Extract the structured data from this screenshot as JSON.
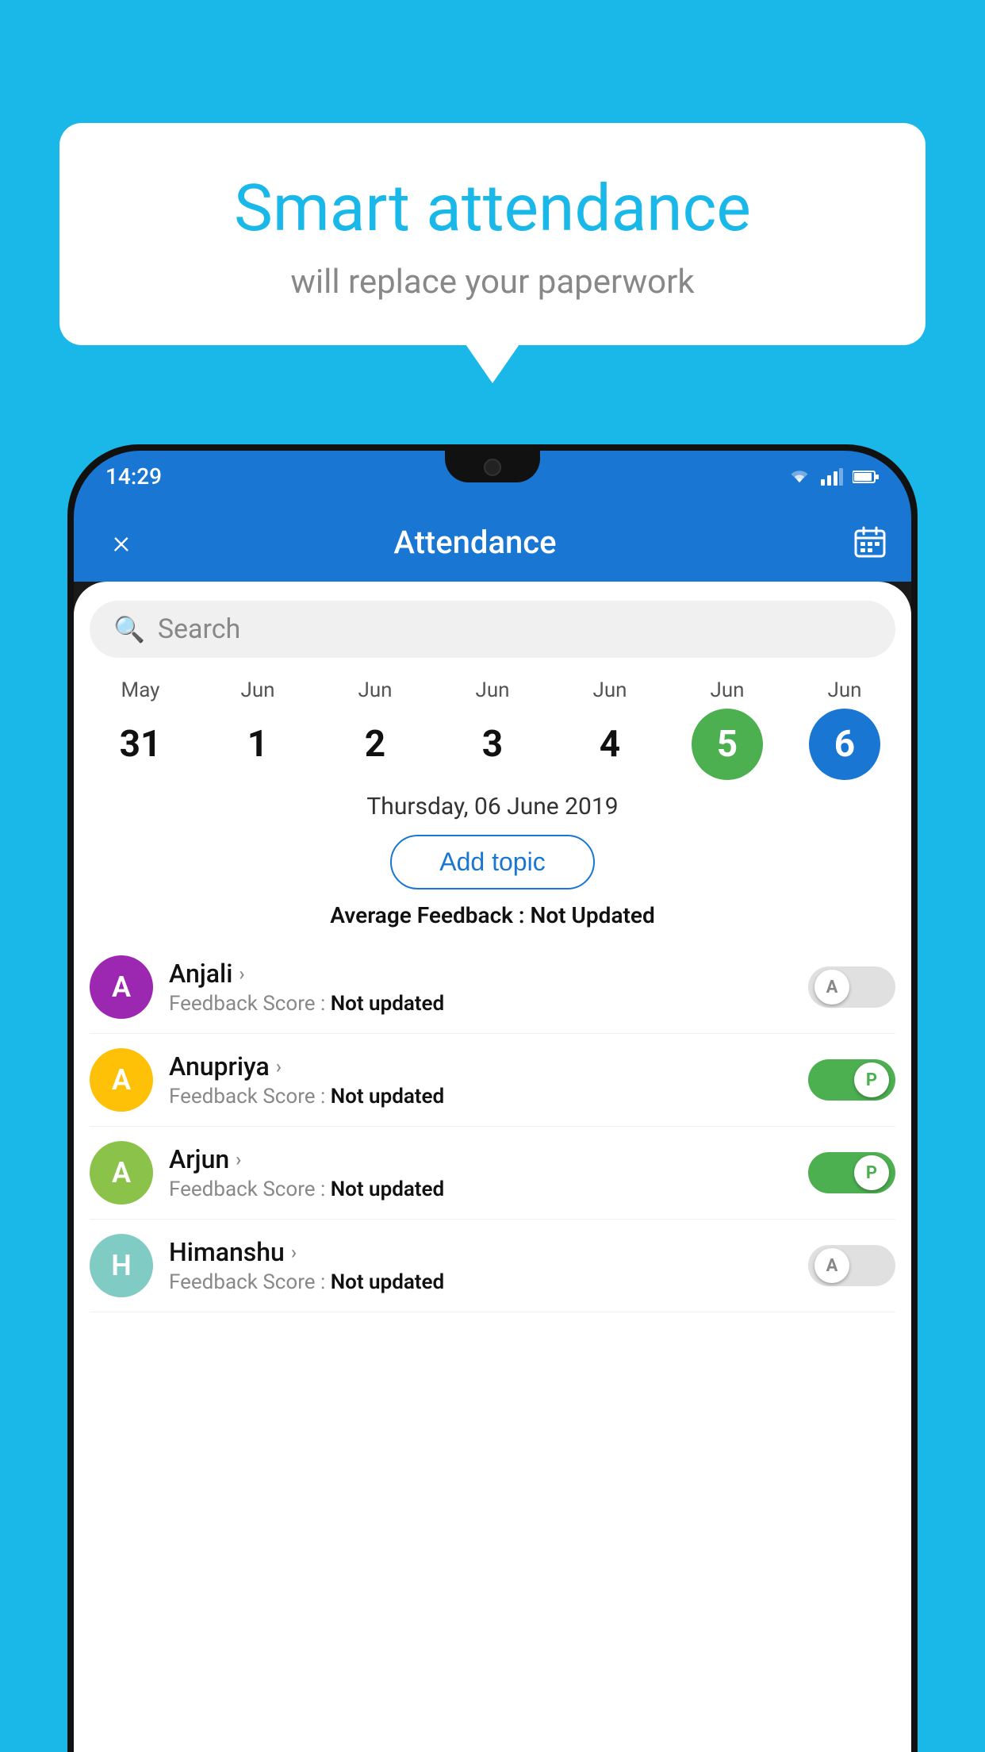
{
  "page": {
    "background_color": "#1ab8e8"
  },
  "bubble": {
    "title": "Smart attendance",
    "subtitle": "will replace your paperwork"
  },
  "status_bar": {
    "time": "14:29",
    "icons": [
      "wifi",
      "signal",
      "battery"
    ]
  },
  "app_bar": {
    "title": "Attendance",
    "close_icon": "×",
    "calendar_icon": "📅"
  },
  "search": {
    "placeholder": "Search"
  },
  "calendar": {
    "days": [
      {
        "month": "May",
        "num": "31",
        "state": "normal"
      },
      {
        "month": "Jun",
        "num": "1",
        "state": "normal"
      },
      {
        "month": "Jun",
        "num": "2",
        "state": "normal"
      },
      {
        "month": "Jun",
        "num": "3",
        "state": "normal"
      },
      {
        "month": "Jun",
        "num": "4",
        "state": "normal"
      },
      {
        "month": "Jun",
        "num": "5",
        "state": "today"
      },
      {
        "month": "Jun",
        "num": "6",
        "state": "selected"
      }
    ],
    "selected_date": "Thursday, 06 June 2019"
  },
  "add_topic_label": "Add topic",
  "avg_feedback": {
    "label": "Average Feedback : ",
    "value": "Not Updated"
  },
  "students": [
    {
      "name": "Anjali",
      "avatar_letter": "A",
      "avatar_color": "purple",
      "feedback": "Feedback Score : Not updated",
      "toggle_state": "off",
      "toggle_label": "A"
    },
    {
      "name": "Anupriya",
      "avatar_letter": "A",
      "avatar_color": "yellow",
      "feedback": "Feedback Score : Not updated",
      "toggle_state": "on",
      "toggle_label": "P"
    },
    {
      "name": "Arjun",
      "avatar_letter": "A",
      "avatar_color": "green",
      "feedback": "Feedback Score : Not updated",
      "toggle_state": "on",
      "toggle_label": "P"
    },
    {
      "name": "Himanshu",
      "avatar_letter": "H",
      "avatar_color": "teal",
      "feedback": "Feedback Score : Not updated",
      "toggle_state": "off",
      "toggle_label": "A"
    }
  ]
}
